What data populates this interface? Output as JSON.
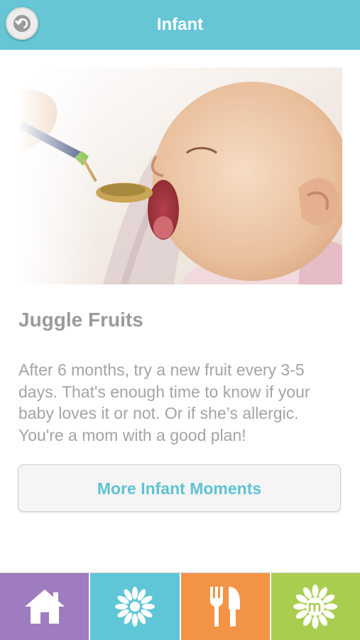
{
  "header": {
    "title": "Infant",
    "back_icon": "back-arrow-icon"
  },
  "article": {
    "image_alt": "Baby being fed fruit puree from a spoon",
    "headline": "Juggle Fruits",
    "body": "After 6 months, try a new fruit every 3-5 days. That's enough time to know if your baby loves it or not. Or if she’s allergic. You're a mom with a good plan!",
    "more_button": "More Infant Moments"
  },
  "tabbar": {
    "tabs": [
      {
        "name": "home",
        "icon": "home-icon",
        "color": "#9f7bbf"
      },
      {
        "name": "moments",
        "icon": "flower-icon",
        "color": "#5fc6d8"
      },
      {
        "name": "food",
        "icon": "fork-knife-icon",
        "color": "#f39345"
      },
      {
        "name": "brand",
        "icon": "m-logo-icon",
        "color": "#a9cd4e"
      }
    ]
  },
  "colors": {
    "header": "#66c6d6",
    "accent": "#5fc2d2",
    "text_gray": "#9b9b9b"
  }
}
